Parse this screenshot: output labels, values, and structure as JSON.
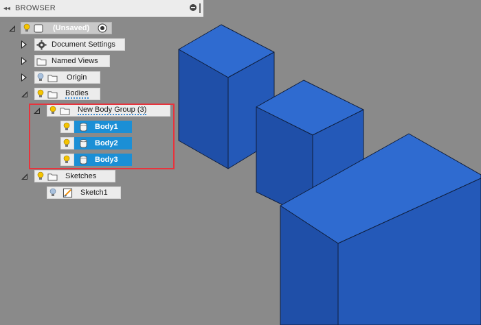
{
  "browser": {
    "title": "BROWSER"
  },
  "tree": {
    "root": {
      "label": "(Unsaved)"
    },
    "document_settings": {
      "label": "Document Settings"
    },
    "named_views": {
      "label": "Named Views"
    },
    "origin": {
      "label": "Origin"
    },
    "bodies": {
      "label": "Bodies"
    },
    "body_group": {
      "label": "New Body Group (3)"
    },
    "bodies_list": [
      {
        "label": "Body1"
      },
      {
        "label": "Body2"
      },
      {
        "label": "Body3"
      }
    ],
    "sketches": {
      "label": "Sketches"
    },
    "sketch1": {
      "label": "Sketch1"
    }
  },
  "colors": {
    "viewport_bg": "#8a8a8a",
    "panel_bg": "#ececec",
    "selection": "#1b8fd6",
    "body_front": "#2257b4",
    "body_top": "#2f6bd0",
    "body_side": "#1a4596",
    "highlight_border": "#e8333c",
    "bulb_on": "#f5c400",
    "bulb_off": "#a9c1dd"
  }
}
